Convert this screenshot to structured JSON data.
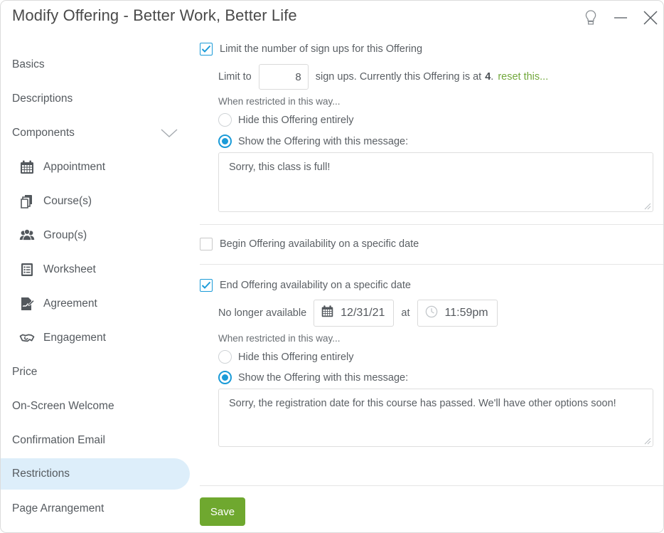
{
  "window": {
    "title": "Modify Offering - Better Work, Better Life",
    "hint_icon": "lightbulb-icon",
    "minimize_icon": "minimize-icon",
    "close_icon": "close-icon"
  },
  "sidebar": {
    "items": [
      {
        "label": "Basics",
        "icon": null,
        "selected": false,
        "sub": false
      },
      {
        "label": "Descriptions",
        "icon": null,
        "selected": false,
        "sub": false
      },
      {
        "label": "Components",
        "icon": null,
        "selected": false,
        "sub": false,
        "expander": "chevron-down-icon"
      },
      {
        "label": "Appointment",
        "icon": "calendar-icon",
        "selected": false,
        "sub": true
      },
      {
        "label": "Course(s)",
        "icon": "pages-icon",
        "selected": false,
        "sub": true
      },
      {
        "label": "Group(s)",
        "icon": "people-icon",
        "selected": false,
        "sub": true
      },
      {
        "label": "Worksheet",
        "icon": "list-icon",
        "selected": false,
        "sub": true
      },
      {
        "label": "Agreement",
        "icon": "signed-document-icon",
        "selected": false,
        "sub": true
      },
      {
        "label": "Engagement",
        "icon": "handshake-icon",
        "selected": false,
        "sub": true
      },
      {
        "label": "Price",
        "icon": null,
        "selected": false,
        "sub": false
      },
      {
        "label": "On-Screen Welcome",
        "icon": null,
        "selected": false,
        "sub": false
      },
      {
        "label": "Confirmation Email",
        "icon": null,
        "selected": false,
        "sub": false
      },
      {
        "label": "Restrictions",
        "icon": null,
        "selected": true,
        "sub": false
      },
      {
        "label": "Page Arrangement",
        "icon": null,
        "selected": false,
        "sub": false
      }
    ]
  },
  "restrictions": {
    "signup_limit": {
      "checkbox_label": "Limit the number of sign ups for this Offering",
      "checked": true,
      "limit_prefix": "Limit to",
      "limit_value": "8",
      "limit_suffix_before": "sign ups. Currently this Offering is at",
      "current_count": "4",
      "limit_suffix_after": ".",
      "reset_link": "reset this...",
      "when_restricted_label": "When restricted in this way...",
      "option_hide": "Hide this Offering entirely",
      "option_show": "Show the Offering with this message:",
      "selected_option": "show",
      "message": "Sorry, this class is full!"
    },
    "begin_date": {
      "checkbox_label": "Begin Offering availability on a specific date",
      "checked": false
    },
    "end_date": {
      "checkbox_label": "End Offering availability on a specific date",
      "checked": true,
      "date_prefix": "No longer available",
      "date_value": "12/31/21",
      "date_icon": "calendar-icon",
      "at_label": "at",
      "time_value": "11:59pm",
      "time_icon": "clock-icon",
      "when_restricted_label": "When restricted in this way...",
      "option_hide": "Hide this Offering entirely",
      "option_show": "Show the Offering with this message:",
      "selected_option": "show",
      "message": "Sorry, the registration date for this course has passed.  We'll have other options soon!"
    },
    "save_label": "Save"
  },
  "colors": {
    "accent_blue": "#1b9bd8",
    "selected_nav_bg": "#ddeefa",
    "save_green": "#6fa82f",
    "link_green": "#72a83c"
  }
}
